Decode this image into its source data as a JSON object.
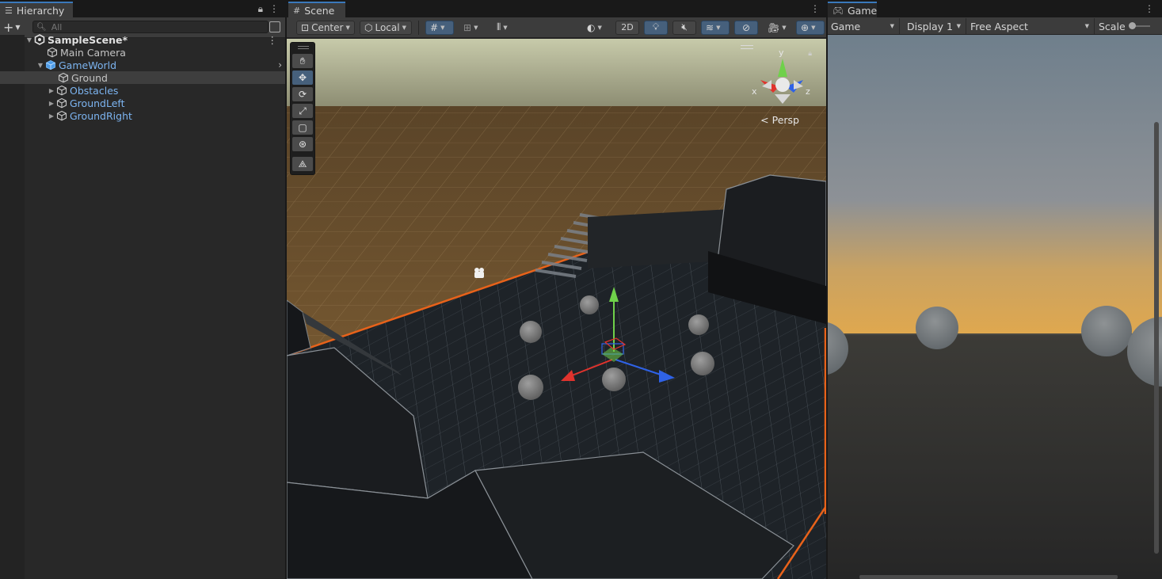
{
  "hierarchy": {
    "tab_label": "Hierarchy",
    "add_label": "+",
    "search_placeholder": "All",
    "items": [
      {
        "label": "SampleScene*",
        "kind": "scene"
      },
      {
        "label": "Main Camera",
        "kind": "object"
      },
      {
        "label": "GameWorld",
        "kind": "prefab"
      },
      {
        "label": "Ground",
        "kind": "object"
      },
      {
        "label": "Obstacles",
        "kind": "prefab"
      },
      {
        "label": "GroundLeft",
        "kind": "prefab"
      },
      {
        "label": "GroundRight",
        "kind": "prefab"
      }
    ]
  },
  "scene": {
    "tab_label": "Scene",
    "pivot_mode": "Center",
    "pivot_rotation": "Local",
    "two_d_label": "2D",
    "projection_label": "Persp",
    "axis_labels": {
      "y": "y",
      "x": "x",
      "z": "z"
    },
    "tools": [
      "hand-tool",
      "move-tool",
      "rotate-tool",
      "scale-tool",
      "rect-tool",
      "transform-tool",
      "custom-tool"
    ],
    "active_tool": "move-tool"
  },
  "game": {
    "tab_label": "Game",
    "mode": "Game",
    "display": "Display 1",
    "aspect": "Free Aspect",
    "scale_label": "Scale"
  },
  "colors": {
    "accent": "#3a79bb",
    "prefab_text": "#7cb4f0",
    "selection_bg": "#46607c",
    "boundary_orange": "#e8621a"
  }
}
